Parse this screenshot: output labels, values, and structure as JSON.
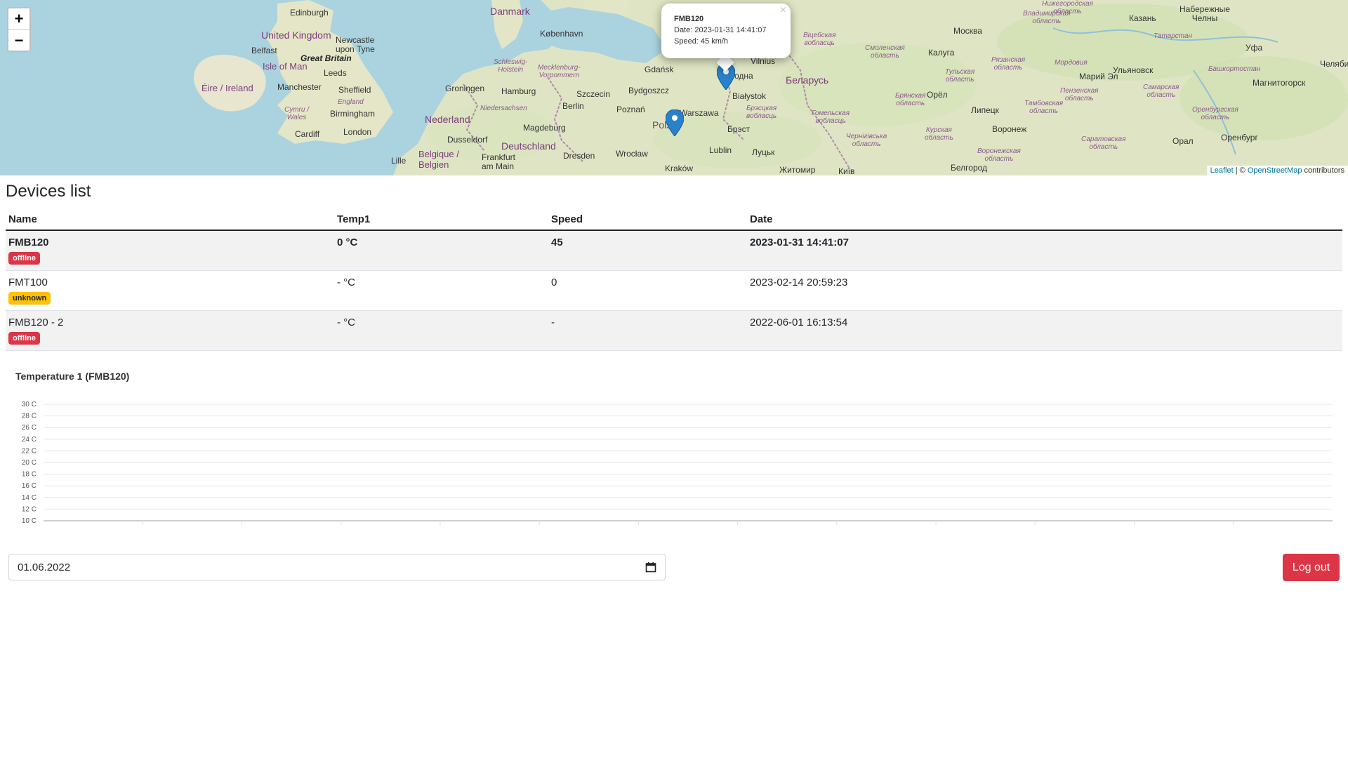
{
  "map": {
    "zoom_in": "+",
    "zoom_out": "−",
    "labels": {
      "edinburgh": "Edinburgh",
      "uk": "United Kingdom",
      "newcastle": "Newcastle\nupon Tyne",
      "belfast": "Belfast",
      "isle_of_man": "Isle of Man",
      "great_britain": "Great Britain",
      "leeds": "Leeds",
      "eire": "Éire / Ireland",
      "manchester": "Manchester",
      "sheffield": "Sheffield",
      "england": "England",
      "cymru": "Cymru /\nWales",
      "birmingham": "Birmingham",
      "cardiff": "Cardiff",
      "london": "London",
      "lille": "Lille",
      "belgique": "Belgique /\nBelgien",
      "danmark": "Danmark",
      "kobenhavn": "København",
      "schleswig": "Schleswig-\nHolstein",
      "mecklenburg": "Mecklenburg-\nVorpommern",
      "groningen": "Groningen",
      "hamburg": "Hamburg",
      "szczecin": "Szczecin",
      "nederland": "Nederland",
      "niedersachsen": "Niedersachsen",
      "berlin": "Berlin",
      "dusseldorf": "Dusseldorf",
      "magdeburg": "Magdeburg",
      "deutschland": "Deutschland",
      "frankfurt": "Frankfurt\nam Main",
      "dresden": "Dresden",
      "gdansk": "Gdańsk",
      "bydgoszcz": "Bydgoszcz",
      "poznan": "Poznań",
      "warszawa": "Warszawa",
      "polska": "Pols",
      "wroclaw": "Wrocław",
      "krakow": "Kraków",
      "lublin": "Lublin",
      "bialystok": "Białystok",
      "grodna": "одна",
      "vilnius": "Vilnius",
      "belarus": "Беларусь",
      "brest": "Брэст",
      "brestskaya": "Брэсцкая\nвобласць",
      "minsk_reg": "Гомельская\nвобласць",
      "vitebsk": "Віцебская\nвобласць",
      "lutsk": "Луцьк",
      "zhytomyr": "Житомир",
      "kyiv": "Київ",
      "chernihiv": "Чернігівська\nобласть",
      "smolensk": "Смоленская\nобласть",
      "bryansk": "Брянская\nобласть",
      "kaluga": "Калуга",
      "moskva": "Москва",
      "oryol": "Орёл",
      "kursk": "Курская\nобласть",
      "lipetsk": "Липецк",
      "voronezh": "Воронеж",
      "voronezh_reg": "Воронежская\nобласть",
      "belgorod": "Белгород",
      "tula": "Тульская\nобласть",
      "ryazan": "Рязанская\nобласть",
      "tambov": "Тамбовская\nобласть",
      "penza": "Пензенская\nобласть",
      "saratov": "Саратовская\nобласть",
      "mordovia": "Мордовия",
      "vladimir": "Владимирская\nобласть",
      "nizhny": "Нижегородская\nобласть",
      "kazan": "Казань",
      "tatarstan": "Татарстан",
      "chelny": "Набережные\nЧелны",
      "ulyanovsk": "Ульяновск",
      "samara_reg": "Самарская\nобласть",
      "orenburg_reg": "Оренбургская\nобласть",
      "orenburg": "Оренбург",
      "oral": "Орал",
      "ufa": "Уфа",
      "bashkortostan": "Башкортостан",
      "magnitogorsk": "Магнитогорск",
      "mariel": "Марий Эл",
      "chelyab": "Челяби"
    },
    "popup": {
      "title": "FMB120",
      "date_line": "Date: 2023-01-31 14:41:07",
      "speed_line": "Speed: 45 km/h",
      "close": "×"
    },
    "attribution": {
      "leaflet": "Leaflet",
      "sep": " | © ",
      "osm": "OpenStreetMap",
      "suffix": " contributors"
    }
  },
  "devices": {
    "title": "Devices list",
    "columns": [
      "Name",
      "Temp1",
      "Speed",
      "Date"
    ],
    "rows": [
      {
        "name": "FMB120",
        "status": "offline",
        "temp": "0 °C",
        "speed": "45",
        "date": "2023-01-31 14:41:07"
      },
      {
        "name": "FMT100",
        "status": "unknown",
        "temp": "- °C",
        "speed": "0",
        "date": "2023-02-14 20:59:23"
      },
      {
        "name": "FMB120 - 2",
        "status": "offline",
        "temp": "- °C",
        "speed": "-",
        "date": "2022-06-01 16:13:54"
      }
    ]
  },
  "chart_data": {
    "type": "line",
    "title": "Temperature 1 (FMB120)",
    "y_ticks": [
      "30 C",
      "28 C",
      "26 C",
      "24 C",
      "22 C",
      "20 C",
      "18 C",
      "16 C",
      "14 C",
      "12 C",
      "10 C"
    ],
    "ylim": [
      10,
      30
    ],
    "grid": true,
    "series": []
  },
  "controls": {
    "date_value": "01.06.2022",
    "logout_label": "Log out"
  },
  "colors": {
    "danger": "#dc3545",
    "warning": "#ffc107",
    "marker": "#2a81cb",
    "water": "#aad3df"
  }
}
